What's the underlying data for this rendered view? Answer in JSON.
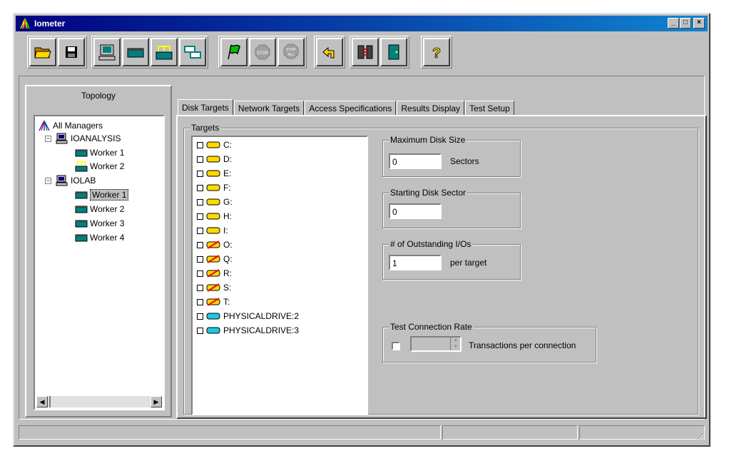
{
  "window": {
    "title": "Iometer",
    "controls": [
      "_",
      "□",
      "×"
    ]
  },
  "toolbar": {
    "buttons": [
      {
        "name": "open-config-button",
        "icon": "folder-open-icon"
      },
      {
        "name": "save-config-button",
        "icon": "floppy-disk-icon"
      },
      {
        "name": "start-disk-worker-button",
        "icon": "computer-icon"
      },
      {
        "name": "start-disk-worker-2-button",
        "icon": "disk-worker-icon"
      },
      {
        "name": "start-network-worker-button",
        "icon": "network-worker-icon"
      },
      {
        "name": "duplicate-worker-button",
        "icon": "duplicate-icon"
      },
      {
        "name": "start-tests-button",
        "icon": "green-flag-icon"
      },
      {
        "name": "stop-button",
        "icon": "stop-sign-icon"
      },
      {
        "name": "stop-all-button",
        "icon": "stop-all-icon"
      },
      {
        "name": "reset-workers-button",
        "icon": "reset-arrow-icon"
      },
      {
        "name": "start-managers-button",
        "icon": "manager-icon"
      },
      {
        "name": "exit-button",
        "icon": "exit-door-icon"
      },
      {
        "name": "help-button",
        "icon": "question-mark-icon"
      }
    ]
  },
  "topology": {
    "title": "Topology",
    "root": "All Managers",
    "managers": [
      {
        "name": "IOANALYSIS",
        "workers": [
          "Worker 1",
          "Worker 2"
        ]
      },
      {
        "name": "IOLAB",
        "workers": [
          "Worker 1",
          "Worker 2",
          "Worker 3",
          "Worker 4"
        ]
      }
    ],
    "selected": "IOLAB / Worker 1"
  },
  "tabs": [
    {
      "label": "Disk Targets",
      "active": true
    },
    {
      "label": "Network Targets",
      "active": false
    },
    {
      "label": "Access Specifications",
      "active": false
    },
    {
      "label": "Results Display",
      "active": false
    },
    {
      "label": "Test Setup",
      "active": false
    }
  ],
  "disk_targets": {
    "targets_label": "Targets",
    "targets": [
      {
        "label": "C:",
        "type": "drive-ok"
      },
      {
        "label": "D:",
        "type": "drive-ok"
      },
      {
        "label": "E:",
        "type": "drive-ok"
      },
      {
        "label": "F:",
        "type": "drive-ok"
      },
      {
        "label": "G:",
        "type": "drive-ok"
      },
      {
        "label": "H:",
        "type": "drive-ok"
      },
      {
        "label": "I:",
        "type": "drive-ok"
      },
      {
        "label": "O:",
        "type": "drive-unprepared"
      },
      {
        "label": "Q:",
        "type": "drive-unprepared"
      },
      {
        "label": "R:",
        "type": "drive-unprepared"
      },
      {
        "label": "S:",
        "type": "drive-unprepared"
      },
      {
        "label": "T:",
        "type": "drive-unprepared"
      },
      {
        "label": "PHYSICALDRIVE:2",
        "type": "physical-drive"
      },
      {
        "label": "PHYSICALDRIVE:3",
        "type": "physical-drive"
      }
    ],
    "max_disk_size": {
      "label": "Maximum Disk Size",
      "value": "0",
      "unit": "Sectors"
    },
    "starting_sector": {
      "label": "Starting Disk Sector",
      "value": "0"
    },
    "outstanding_ios": {
      "label": "# of Outstanding I/Os",
      "value": "1",
      "unit": "per target"
    },
    "connection_rate": {
      "label": "Test Connection Rate",
      "value": "",
      "unit": "Transactions per connection"
    }
  },
  "colors": {
    "titlebar": "#000080",
    "drive_yellow": "#ffd800",
    "drive_cyan": "#21c6de",
    "unprepared_mark": "#ff0000"
  }
}
